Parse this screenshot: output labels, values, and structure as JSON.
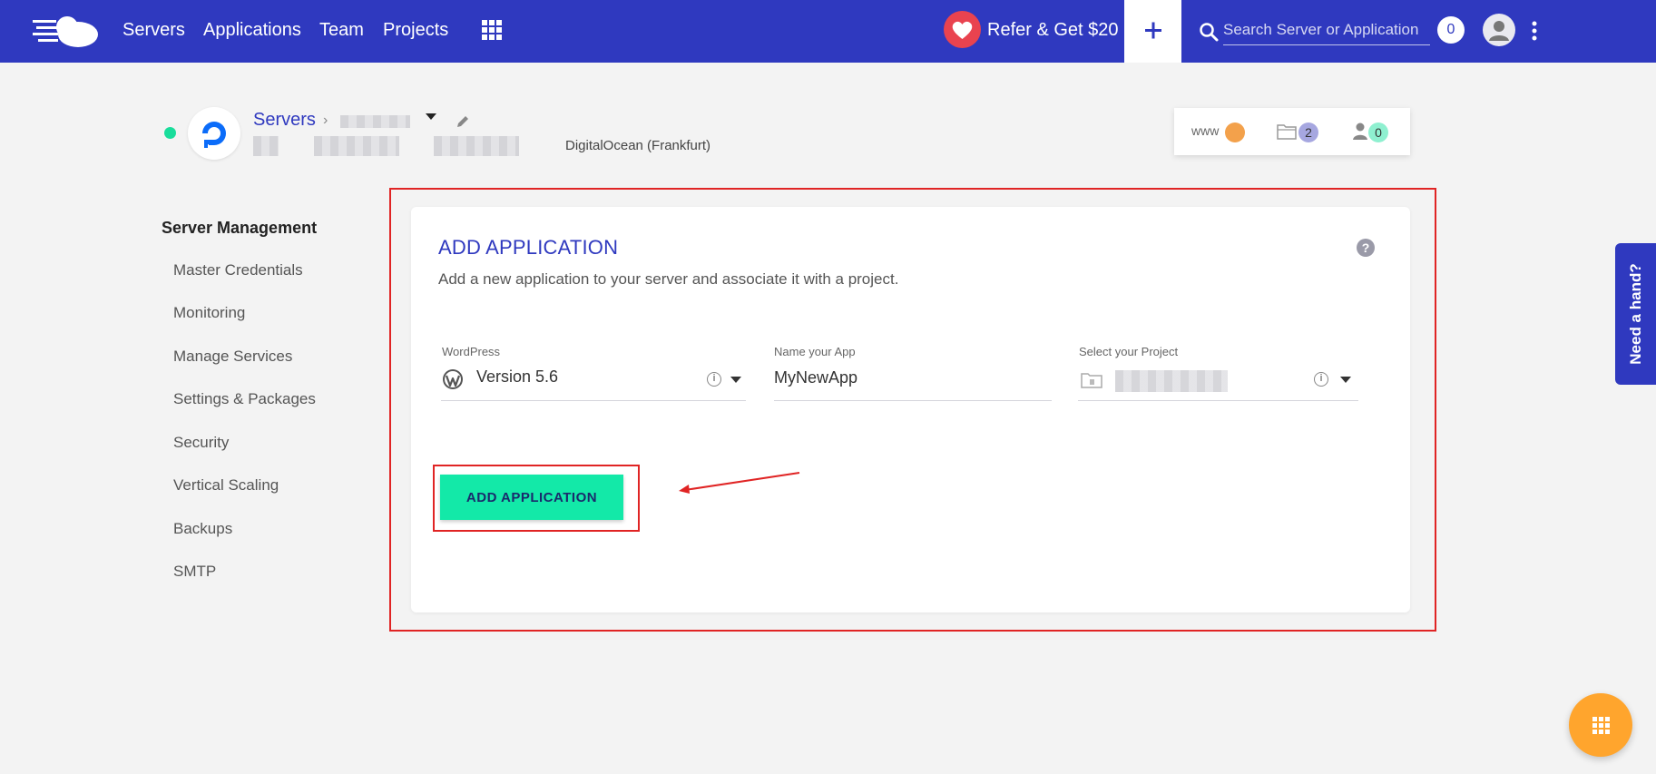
{
  "nav": {
    "items": [
      "Servers",
      "Applications",
      "Team",
      "Projects"
    ],
    "refer_label": "Refer & Get $20",
    "search_placeholder": "Search Server or Application",
    "notifications_count": "0"
  },
  "server": {
    "breadcrumb_root": "Servers",
    "provider": "DigitalOcean (Frankfurt)",
    "stats": {
      "www": "www",
      "folders": "2",
      "members": "0"
    }
  },
  "sidebar": {
    "title": "Server Management",
    "items": [
      "Master Credentials",
      "Monitoring",
      "Manage Services",
      "Settings & Packages",
      "Security",
      "Vertical Scaling",
      "Backups",
      "SMTP"
    ]
  },
  "card": {
    "title": "ADD APPLICATION",
    "description": "Add a new application to your server and associate it with a project.",
    "help": "?",
    "fields": {
      "app_type_label": "WordPress",
      "app_version": "Version 5.6",
      "name_label": "Name your App",
      "name_value": "MyNewApp",
      "project_label": "Select your Project"
    },
    "info": "i",
    "submit_label": "ADD APPLICATION"
  },
  "help_tab": "Need a hand?",
  "colors": {
    "brand": "#2f39bf",
    "accent": "#13e9a8",
    "fab": "#ffa52d",
    "annotation": "#e02424"
  }
}
